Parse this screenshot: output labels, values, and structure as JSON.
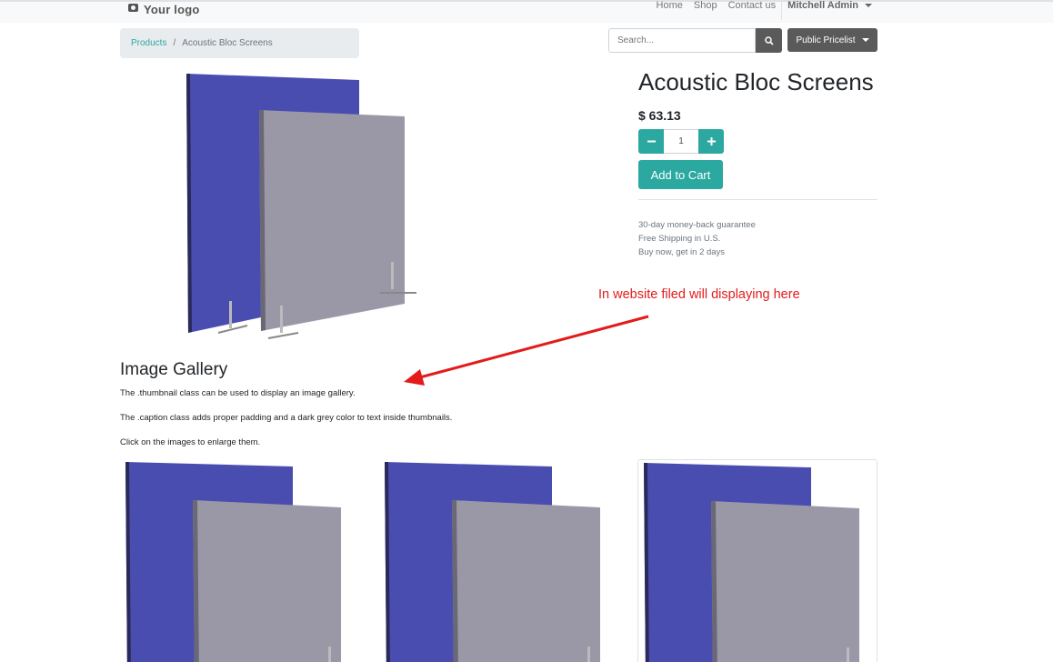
{
  "navbar": {
    "logo_text": "Your logo",
    "links": [
      "Home",
      "Shop",
      "Contact us"
    ],
    "user": "Mitchell Admin"
  },
  "breadcrumb": {
    "parent": "Products",
    "current": "Acoustic Bloc Screens"
  },
  "search": {
    "placeholder": "Search..."
  },
  "pricelist": {
    "label": "Public Pricelist"
  },
  "product": {
    "name": "Acoustic Bloc Screens",
    "price": "$ 63.13",
    "quantity": "1",
    "add_to_cart": "Add to Cart",
    "guarantee": [
      "30-day money-back guarantee",
      "Free Shipping in U.S.",
      "Buy now, get in 2 days"
    ]
  },
  "annotation": {
    "text": "In website filed will displaying here"
  },
  "gallery": {
    "title": "Image Gallery",
    "lines": [
      "The .thumbnail class can be used to display an image gallery.",
      "The .caption class adds proper padding and a dark grey color to text inside thumbnails.",
      "Click on the images to enlarge them."
    ]
  },
  "colors": {
    "accent": "#2ba8a0",
    "dark_button": "#5a5a5a",
    "annotation": "#e31b1b",
    "panel_blue": "#4a4db0",
    "panel_grey": "#9a98a6"
  }
}
